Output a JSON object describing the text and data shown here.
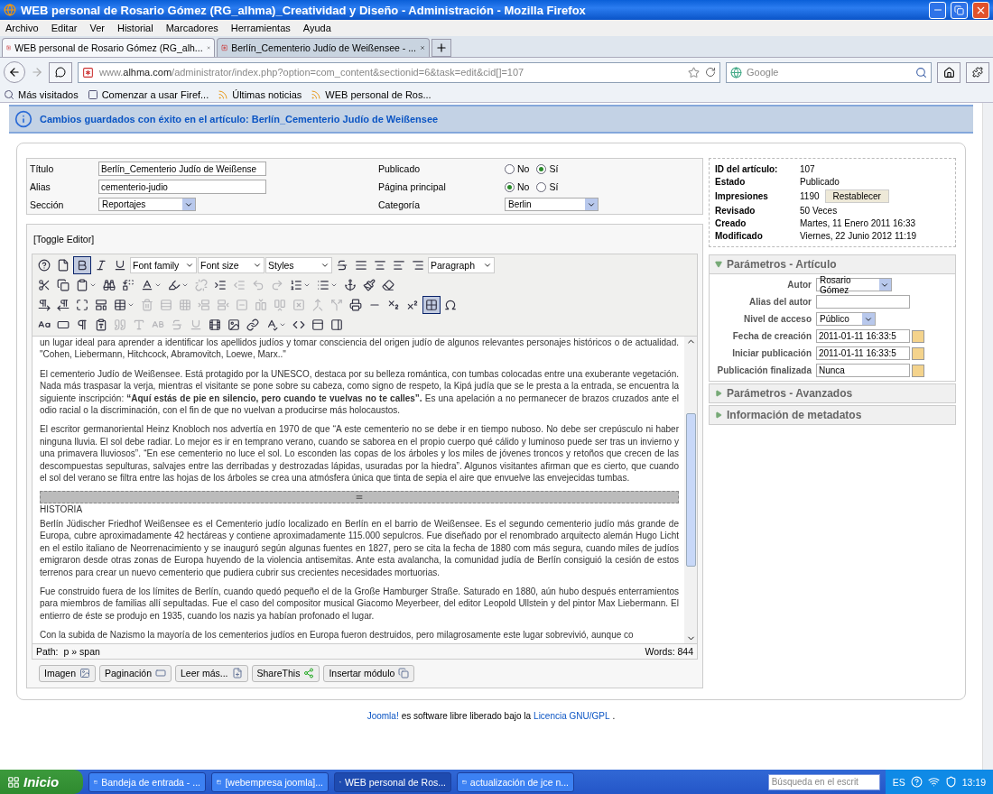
{
  "window": {
    "title": "WEB personal de Rosario Gómez (RG_alhma)_Creatividad y Diseño - Administración - Mozilla Firefox"
  },
  "menu": [
    "Archivo",
    "Editar",
    "Ver",
    "Historial",
    "Marcadores",
    "Herramientas",
    "Ayuda"
  ],
  "tabs": [
    {
      "label": "WEB personal de Rosario Gómez (RG_alh...",
      "selected": true
    },
    {
      "label": "Berlín_Cementerio Judío de Weißensee - ...",
      "selected": false
    }
  ],
  "address": {
    "prefix": "www.",
    "host": "alhma.com",
    "path": "/administrator/index.php?option=com_content&sectionid=6&task=edit&cid[]=107"
  },
  "search": {
    "placeholder": "Google"
  },
  "bookmarks": [
    {
      "label": "Más visitados",
      "kind": "star"
    },
    {
      "label": "Comenzar a usar Firef...",
      "kind": "page"
    },
    {
      "label": "Últimas noticias",
      "kind": "feed"
    },
    {
      "label": "WEB personal de Ros...",
      "kind": "feed"
    }
  ],
  "message": "Cambios guardados con éxito en el artículo: Berlín_Cementerio Judío de Weißensee",
  "form": {
    "left": [
      {
        "label": "Título",
        "kind": "input",
        "value": "Berlín_Cementerio Judío de Weißense"
      },
      {
        "label": "Alias",
        "kind": "input",
        "value": "cementerio-judio"
      },
      {
        "label": "Sección",
        "kind": "select",
        "value": "Reportajes"
      }
    ],
    "right": [
      {
        "label": "Publicado",
        "kind": "radio",
        "options": [
          {
            "label": "No",
            "selected": false
          },
          {
            "label": "Sí",
            "selected": true
          }
        ]
      },
      {
        "label": "Página principal",
        "kind": "radio",
        "options": [
          {
            "label": "No",
            "selected": true
          },
          {
            "label": "Sí",
            "selected": false
          }
        ]
      },
      {
        "label": "Categoría",
        "kind": "select",
        "value": "Berlin"
      }
    ]
  },
  "editor": {
    "toggle": "[Toggle Editor]",
    "toolbar": [
      [
        {
          "kind": "icon",
          "selected": false,
          "disabled": false
        },
        {
          "kind": "icon",
          "selected": false,
          "disabled": false
        },
        {
          "kind": "icon",
          "selected": true,
          "disabled": false
        },
        {
          "kind": "icon",
          "selected": false,
          "disabled": false
        },
        {
          "kind": "icon",
          "selected": false,
          "disabled": false
        },
        {
          "kind": "select",
          "label": "Font family"
        },
        {
          "kind": "select",
          "label": "Font size"
        },
        {
          "kind": "select",
          "label": "Styles"
        },
        {
          "kind": "icon",
          "selected": false,
          "disabled": false
        },
        {
          "kind": "icon",
          "selected": false,
          "disabled": false
        },
        {
          "kind": "icon",
          "selected": false,
          "disabled": false
        },
        {
          "kind": "icon",
          "selected": false,
          "disabled": false
        },
        {
          "kind": "icon",
          "selected": false,
          "disabled": false
        },
        {
          "kind": "select",
          "label": "Paragraph"
        }
      ],
      [
        {
          "kind": "icon",
          "selected": false,
          "disabled": false
        },
        {
          "kind": "icon",
          "selected": false,
          "disabled": false
        },
        {
          "kind": "split",
          "selected": false,
          "disabled": false
        },
        {
          "kind": "icon",
          "selected": false,
          "disabled": false
        },
        {
          "kind": "icon",
          "selected": false,
          "disabled": false
        },
        {
          "kind": "split",
          "selected": false,
          "disabled": false
        },
        {
          "kind": "split",
          "selected": false,
          "disabled": false
        },
        {
          "kind": "icon",
          "selected": false,
          "disabled": true
        },
        {
          "kind": "icon",
          "selected": false,
          "disabled": false
        },
        {
          "kind": "icon",
          "selected": false,
          "disabled": true
        },
        {
          "kind": "icon",
          "selected": false,
          "disabled": true
        },
        {
          "kind": "icon",
          "selected": false,
          "disabled": true
        },
        {
          "kind": "split",
          "selected": false,
          "disabled": false
        },
        {
          "kind": "split",
          "selected": false,
          "disabled": false
        },
        {
          "kind": "icon",
          "selected": false,
          "disabled": false
        },
        {
          "kind": "icon",
          "selected": false,
          "disabled": false
        },
        {
          "kind": "icon",
          "selected": false,
          "disabled": false
        }
      ],
      [
        {
          "kind": "icon",
          "selected": false,
          "disabled": false
        },
        {
          "kind": "icon",
          "selected": false,
          "disabled": false
        },
        {
          "kind": "icon",
          "selected": false,
          "disabled": false
        },
        {
          "kind": "icon",
          "selected": false,
          "disabled": false
        },
        {
          "kind": "split",
          "selected": false,
          "disabled": false
        },
        {
          "kind": "icon",
          "selected": false,
          "disabled": true
        },
        {
          "kind": "icon",
          "selected": false,
          "disabled": true
        },
        {
          "kind": "icon",
          "selected": false,
          "disabled": true
        },
        {
          "kind": "icon",
          "selected": false,
          "disabled": true
        },
        {
          "kind": "icon",
          "selected": false,
          "disabled": true
        },
        {
          "kind": "icon",
          "selected": false,
          "disabled": true
        },
        {
          "kind": "icon",
          "selected": false,
          "disabled": true
        },
        {
          "kind": "icon",
          "selected": false,
          "disabled": true
        },
        {
          "kind": "icon",
          "selected": false,
          "disabled": true
        },
        {
          "kind": "icon",
          "selected": false,
          "disabled": true
        },
        {
          "kind": "icon",
          "selected": false,
          "disabled": true
        },
        {
          "kind": "icon",
          "selected": false,
          "disabled": false
        },
        {
          "kind": "icon",
          "selected": false,
          "disabled": false
        },
        {
          "kind": "icon",
          "selected": false,
          "disabled": false
        },
        {
          "kind": "icon",
          "selected": false,
          "disabled": false
        },
        {
          "kind": "icon",
          "selected": true,
          "disabled": false
        },
        {
          "kind": "icon",
          "selected": false,
          "disabled": false
        }
      ],
      [
        {
          "kind": "icon",
          "selected": false,
          "disabled": false
        },
        {
          "kind": "icon",
          "selected": false,
          "disabled": false
        },
        {
          "kind": "icon",
          "selected": false,
          "disabled": false
        },
        {
          "kind": "icon",
          "selected": false,
          "disabled": false
        },
        {
          "kind": "icon",
          "selected": false,
          "disabled": true
        },
        {
          "kind": "icon",
          "selected": false,
          "disabled": true
        },
        {
          "kind": "icon",
          "selected": false,
          "disabled": true
        },
        {
          "kind": "icon",
          "selected": false,
          "disabled": true
        },
        {
          "kind": "icon",
          "selected": false,
          "disabled": true
        },
        {
          "kind": "icon",
          "selected": false,
          "disabled": false
        },
        {
          "kind": "icon",
          "selected": false,
          "disabled": false
        },
        {
          "kind": "icon",
          "selected": false,
          "disabled": false
        },
        {
          "kind": "split",
          "selected": false,
          "disabled": false
        },
        {
          "kind": "icon",
          "selected": false,
          "disabled": false
        },
        {
          "kind": "icon",
          "selected": false,
          "disabled": false
        },
        {
          "kind": "icon",
          "selected": false,
          "disabled": false
        }
      ]
    ],
    "blocks": [
      {
        "kind": "paragraph",
        "text": "un lugar ideal para aprender a identificar los apellidos judíos y tomar consciencia del origen judío de algunos relevantes personajes históricos o de actualidad. \"Cohen, Liebermann, Hitchcock, Abramovitch, Loewe, Marx..\""
      },
      {
        "kind": "paragraph",
        "text": "El cementerio Judío de Weißensee. Está protagido por la UNESCO, destaca por su belleza romántica, con tumbas colocadas entre una exuberante vegetación. Nada más traspasar la verja, mientras el visitante se pone sobre su cabeza, como signo de respeto, la Kipá judía que se le presta a la entrada, se encuentra la siguiente inscripción: **“Aquí estás de pie en silencio, pero cuando te vuelvas no te calles”.** Es una apelación a no permanecer de brazos cruzados ante el odio racial o la discriminación, con el fin de que no vuelvan a producirse más holocaustos."
      },
      {
        "kind": "paragraph",
        "text": "El escritor germanoriental Heinz Knobloch nos advertía en 1970 de que “A este cementerio no se debe ir en tiempo nuboso. No debe ser crepúsculo ni haber ninguna lluvia. El sol debe radiar. Lo mejor es ir en temprano verano, cuando se saborea en el propio cuerpo qué cálido y luminoso puede ser tras un invierno y una primavera lluviosos”. “En ese cementerio no luce el sol. Lo esconden las copas de los árboles y los miles de jóvenes troncos y retoños que crecen de las descompuestas sepulturas, salvajes entre las derribadas y destrozadas lápidas, usuradas por la hiedra”. Algunos visitantes afirman que es cierto, que cuando el sol del verano se filtra entre las hojas de los árboles se crea una atmósfera única que tinta de sepia el aire que envuelve las envejecidas tumbas."
      },
      {
        "kind": "pagebreak"
      },
      {
        "kind": "line",
        "text": "HISTORIA"
      },
      {
        "kind": "paragraph",
        "text": "Berlín Jüdischer Friedhof  Weißensee es el Cementerio judío localizado en Berlín en el barrio de Weißensee. Es el segundo cementerio judío más grande de Europa, cubre aproximadamente 42 hectáreas y contiene aproximadamente 115.000 sepulcros. Fue diseñado por el renombrado arquitecto alemán Hugo Licht en el estilo italiano de Neorrenacimiento y se inauguró según algunas fuentes en 1827, pero se cita la fecha de 1880 com más segura, cuando miles de judíos emigraron desde otras zonas de Europa huyendo de la violencia antisemitas. Ante esta avalancha, la comunidad judía de Berlín consiguió la cesión de estos terrenos para crear un nuevo cementerio que pudiera cubrir sus crecientes necesidades mortuorias."
      },
      {
        "kind": "paragraph",
        "text": "Fue construido fuera de los límites de Berlín, cuando quedó pequeño el de la Große Hamburger Straße. Saturado en 1880, aún hubo después enterramientos para miembros de familias allí sepultadas. Fue el caso del compositor musical Giacomo Meyerbeer, del editor Leopold Ullstein y del pintor Max Liebermann. El entierro de éste se produjo en 1935, cuando los nazis ya habían profonado el lugar."
      },
      {
        "kind": "line",
        "text": "Con la subida de Nazismo la mayoría de los cementerios judíos en Europa fueron destruidos, pero milagrosamente este lugar sobrevivió, aunque co"
      }
    ],
    "path_label": "Path:",
    "path": "p » span",
    "words": "Words: 844",
    "buttons": [
      {
        "label": "Imagen",
        "kind": "image"
      },
      {
        "label": "Paginación",
        "kind": "pagebreak"
      },
      {
        "label": "Leer más...",
        "kind": "readmore"
      },
      {
        "label": "ShareThis",
        "kind": "share"
      },
      {
        "label": "Insertar módulo",
        "kind": "module"
      }
    ]
  },
  "info": [
    {
      "label": "ID del artículo:",
      "value": "107"
    },
    {
      "label": "Estado",
      "value": "Publicado"
    },
    {
      "label": "Impresiones",
      "value": "1190",
      "button": "Restablecer"
    },
    {
      "label": "Revisado",
      "value": "50 Veces"
    },
    {
      "label": "Creado",
      "value": "Martes, 11 Enero 2011 16:33"
    },
    {
      "label": "Modificado",
      "value": "Viernes, 22 Junio 2012 11:19"
    }
  ],
  "panels": [
    {
      "title": "Parámetros - Artículo",
      "expanded": true,
      "rows": [
        {
          "label": "Autor",
          "kind": "select",
          "value": "Rosario Gómez"
        },
        {
          "label": "Alias del autor",
          "kind": "input"
        },
        {
          "label": "Nivel de acceso",
          "kind": "select",
          "value": "Público"
        },
        {
          "label": "Fecha de creación",
          "kind": "date",
          "value": "2011-01-11 16:33:5"
        },
        {
          "label": "Iniciar publicación",
          "kind": "date",
          "value": "2011-01-11 16:33:5"
        },
        {
          "label": "Publicación finalizada",
          "kind": "date",
          "value": "Nunca"
        }
      ]
    },
    {
      "title": "Parámetros - Avanzados",
      "expanded": false
    },
    {
      "title": "Información de metadatos",
      "expanded": false
    }
  ],
  "footer": {
    "link1": "Joomla!",
    "text": "es software libre liberado bajo la",
    "link2": "Licencia GNU/GPL",
    "end": "."
  },
  "taskbar": {
    "start": "Inicio",
    "tasks": [
      {
        "label": "Bandeja de entrada - ...",
        "selected": false
      },
      {
        "label": "[webempresa joomla]...",
        "selected": false
      },
      {
        "label": "WEB personal de Ros...",
        "selected": true
      },
      {
        "label": "actualización de jce n...",
        "selected": false
      }
    ],
    "search": "Búsqueda en el escrit",
    "lang": "ES",
    "clock": "13:19"
  }
}
